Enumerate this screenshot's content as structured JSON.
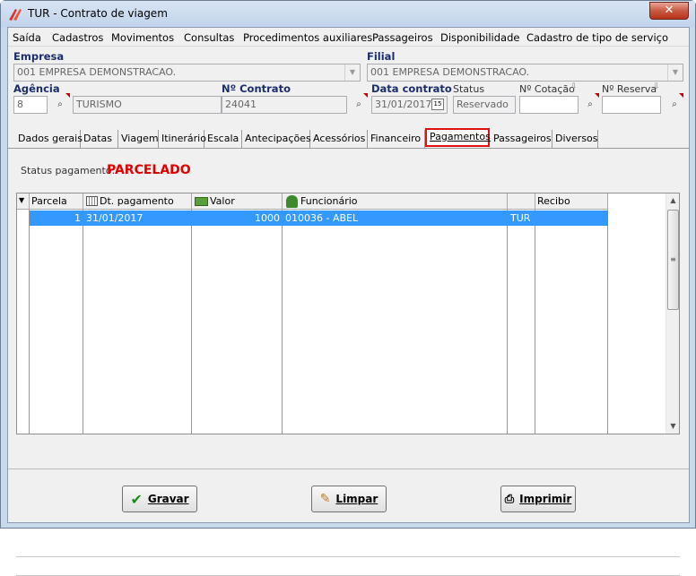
{
  "window": {
    "title": "TUR - Contrato de viagem",
    "close_label": "✕"
  },
  "menu": [
    "Saída",
    "Cadastros",
    "Movimentos",
    "Consultas",
    "Procedimentos auxiliares",
    "Passageiros",
    "Disponibilidade",
    "Cadastro de tipo de serviço"
  ],
  "form": {
    "empresa_label": "Empresa",
    "empresa_value": "001 EMPRESA DEMONSTRACAO.",
    "filial_label": "Filial",
    "filial_value": "001 EMPRESA DEMONSTRACAO.",
    "agencia_label": "Agência",
    "agencia_code": "8",
    "agencia_name": "TURISMO",
    "contrato_label": "Nº Contrato",
    "contrato_value": "24041",
    "data_contrato_label": "Data contrato",
    "data_contrato_value": "31/01/2017",
    "calendar_label": "15",
    "status_label": "Status",
    "status_value": "Reservado",
    "cotacao_label": "Nº Cotação",
    "cotacao_value": "",
    "reserva_label": "Nº Reserva",
    "reserva_value": ""
  },
  "tabs": [
    "Dados gerais",
    "Datas",
    "Viagem",
    "Itinerário",
    "Escala",
    "Antecipações",
    "Acessórios",
    "Financeiro",
    "Pagamentos",
    "Passageiros",
    "Diversos"
  ],
  "active_tab": "Pagamentos",
  "payment": {
    "status_label": "Status pagamento:",
    "status_value": "PARCELADO"
  },
  "grid": {
    "columns": [
      "Parcela",
      "Dt. pagamento",
      "Valor",
      "Funcionário",
      "",
      "Recibo"
    ],
    "rows": [
      {
        "parcela": "1",
        "dt_pagamento": "31/01/2017",
        "valor": "1000",
        "funcionario": "010036 - ABEL",
        "tipo": "TUR",
        "recibo": ""
      }
    ]
  },
  "buttons": {
    "save": "Gravar",
    "clear": "Limpar",
    "print": "Imprimir"
  },
  "colors": {
    "accent_red": "#e00000",
    "selection": "#3399ff",
    "label_blue": "#1a2d6b"
  }
}
